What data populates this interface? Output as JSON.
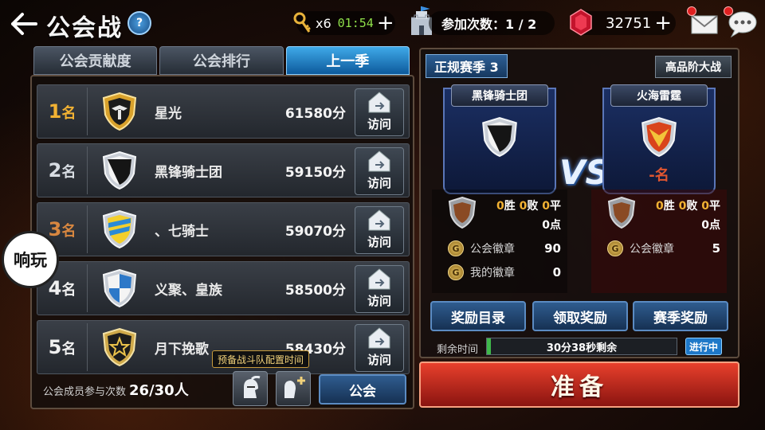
{
  "header": {
    "title": "公会战",
    "help": "?",
    "keys": {
      "count": "x6",
      "timer": "01:54"
    },
    "participation": "参加次数：1 / 2",
    "gems": "32751",
    "plus": "+"
  },
  "tabs": [
    {
      "label": "公会贡献度"
    },
    {
      "label": "公会排行"
    },
    {
      "label": "上一季"
    }
  ],
  "ranking": [
    {
      "rank": "1",
      "unit": "名",
      "name": "星光",
      "score": "61580分",
      "visit": "访问"
    },
    {
      "rank": "2",
      "unit": "名",
      "name": "黑锋骑士团",
      "score": "59150分",
      "visit": "访问"
    },
    {
      "rank": "3",
      "unit": "名",
      "name": "、七骑士",
      "score": "59070分",
      "visit": "访问"
    },
    {
      "rank": "4",
      "unit": "名",
      "name": "义聚、皇族",
      "score": "58500分",
      "visit": "访问"
    },
    {
      "rank": "5",
      "unit": "名",
      "name": "月下挽歌",
      "score": "58430分",
      "visit": "访问"
    }
  ],
  "footer_left": {
    "members_label": "公会成员参与次数",
    "members_value": "26/30人",
    "tooltip": "预备战斗队配置时间",
    "guild_button": "公会"
  },
  "watermark": "响玩",
  "right": {
    "season": "正规赛季 3",
    "tier_button": "高品阶大战",
    "vs": "VS",
    "left_team": {
      "name": "黑锋骑士团",
      "rank": "",
      "win": "0",
      "win_label": "胜",
      "lose": "0",
      "lose_label": "败",
      "draw": "0",
      "draw_label": "平",
      "points": "0点",
      "guild_badge_label": "公会徽章",
      "guild_badge_value": "90",
      "my_badge_label": "我的徽章",
      "my_badge_value": "0"
    },
    "right_team": {
      "name": "火海雷霆",
      "rank": "-名",
      "win": "0",
      "win_label": "胜",
      "lose": "0",
      "lose_label": "败",
      "draw": "0",
      "draw_label": "平",
      "points": "0点",
      "guild_badge_label": "公会徽章",
      "guild_badge_value": "5"
    },
    "buttons": {
      "reward_list": "奖励目录",
      "claim": "领取奖励",
      "season_reward": "赛季奖励"
    },
    "remaining_label": "剩余时间",
    "remaining_text": "30分38秒剩余",
    "remaining_progress": 0.02,
    "status": "进行中",
    "ready": "准备"
  },
  "colors": {
    "accent_blue": "#1e78c8",
    "gold": "#f2b233",
    "danger": "#e8402c"
  }
}
